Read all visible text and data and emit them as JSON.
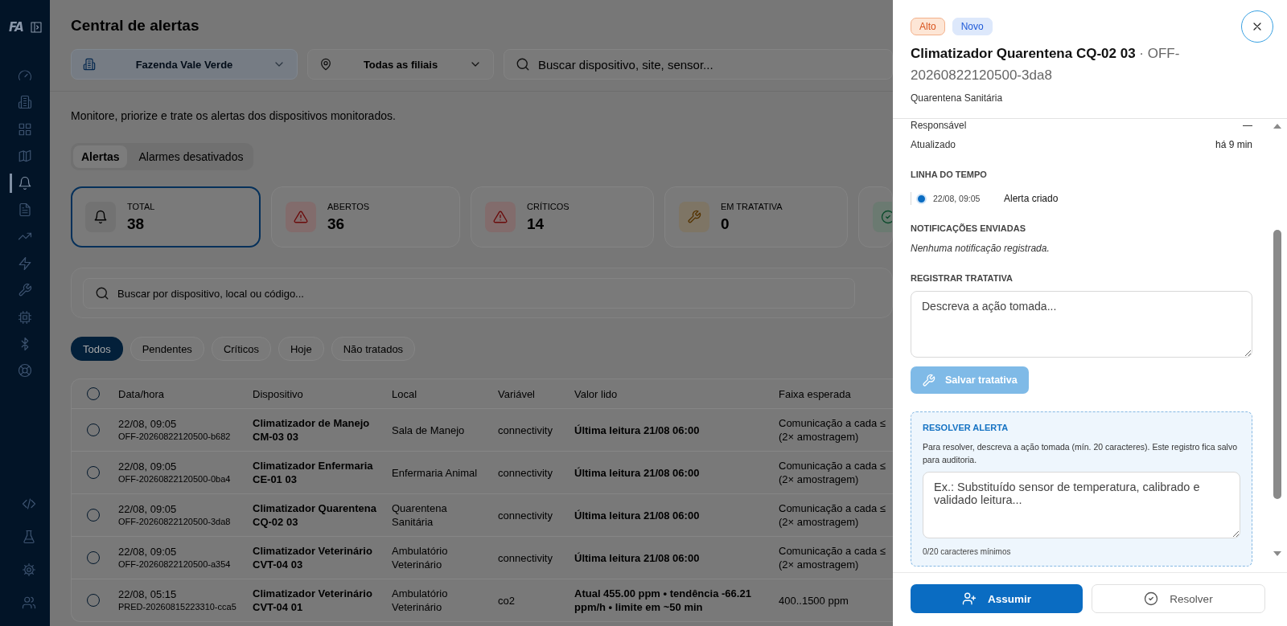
{
  "sidebar": {
    "logo": "FA",
    "items": [
      {
        "selected": false
      },
      {
        "selected": false
      },
      {
        "selected": false
      },
      {
        "selected": false
      },
      {
        "selected": true
      },
      {
        "selected": false
      },
      {
        "selected": false
      },
      {
        "selected": false
      },
      {
        "selected": false
      },
      {
        "selected": false
      },
      {
        "selected": false
      },
      {
        "selected": false
      }
    ],
    "footer_items": [
      {
        "selected": false
      },
      {
        "selected": false
      },
      {
        "selected": false
      },
      {
        "selected": false
      }
    ]
  },
  "page": {
    "title": "Central de alertas",
    "farm_select": {
      "value": "Fazenda Vale Verde"
    },
    "branch_select": {
      "value": "Todas as filiais"
    },
    "search": {
      "placeholder": "Buscar dispositivo, site, sensor..."
    },
    "description": "Monitore, priorize e trate os alertas dos dispositivos monitorados.",
    "tabs": [
      {
        "label": "Alertas",
        "selected": true
      },
      {
        "label": "Alarmes desativados",
        "selected": false
      }
    ],
    "stats": [
      {
        "kind": "total",
        "label": "TOTAL",
        "value": "38",
        "selected": true
      },
      {
        "kind": "open",
        "label": "ABERTOS",
        "value": "36",
        "selected": false
      },
      {
        "kind": "critical",
        "label": "CRÍTICOS",
        "value": "14",
        "selected": false
      },
      {
        "kind": "handling",
        "label": "EM TRATATIVA",
        "value": "0",
        "selected": false
      },
      {
        "kind": "resolved",
        "selected": false
      }
    ],
    "list_search": {
      "placeholder": "Buscar por dispositivo, local ou código..."
    },
    "filters": [
      {
        "label": "Todos",
        "selected": true
      },
      {
        "label": "Pendentes",
        "selected": false
      },
      {
        "label": "Críticos",
        "selected": false
      },
      {
        "label": "Hoje",
        "selected": false
      },
      {
        "label": "Não tratados",
        "selected": false
      }
    ],
    "table": {
      "all_checked": false,
      "columns": [
        "Data/hora",
        "Dispositivo",
        "Local",
        "Variável",
        "Valor lido",
        "Faixa esperada"
      ],
      "rows": [
        {
          "checked": false,
          "time": "22/08, 09:05",
          "code": "OFF-20260822120500-b682",
          "device": "Climatizador de Manejo CM-03 03",
          "local": "Sala de Manejo",
          "variable": "connectivity",
          "value": "Última leitura 21/08 06:00",
          "range": "Comunicação a cada ≤ (2× amostragem)"
        },
        {
          "checked": false,
          "time": "22/08, 09:05",
          "code": "OFF-20260822120500-0ba4",
          "device": "Climatizador Enfermaria CE-01 03",
          "local": "Enfermaria Animal",
          "variable": "connectivity",
          "value": "Última leitura 21/08 06:00",
          "range": "Comunicação a cada ≤ (2× amostragem)"
        },
        {
          "checked": false,
          "time": "22/08, 09:05",
          "code": "OFF-20260822120500-3da8",
          "device": "Climatizador Quarentena CQ-02 03",
          "local": "Quarentena Sanitária",
          "variable": "connectivity",
          "value": "Última leitura 21/08 06:00",
          "range": "Comunicação a cada ≤ (2× amostragem)"
        },
        {
          "checked": false,
          "time": "22/08, 09:05",
          "code": "OFF-20260822120500-a354",
          "device": "Climatizador Veterinário CVT-04 03",
          "local": "Ambulatório Veterinário",
          "variable": "connectivity",
          "value": "Última leitura 21/08 06:00",
          "range": "Comunicação a cada ≤ (2× amostragem)"
        },
        {
          "checked": false,
          "time": "22/08, 05:15",
          "code": "PRED-20260815223310-cca5",
          "device": "Climatizador Veterinário CVT-04 01",
          "local": "Ambulatório Veterinário",
          "variable": "co2",
          "value": "Atual 455.00 ppm • tendência -66.21 ppm/h • limite em ~50 min",
          "range": "400..1500 ppm"
        }
      ]
    }
  },
  "drawer": {
    "badges": [
      {
        "kind": "severity",
        "label": "Alto"
      },
      {
        "kind": "status",
        "label": "Novo"
      }
    ],
    "title": "**Climatizador Quarentena CQ-02 03** · OFF-20260822120500-3da8",
    "location": "Quarentena Sanitária",
    "details": [
      {
        "label": "Responsável",
        "value": "—"
      },
      {
        "label": "Atualizado",
        "value": "há 9 min"
      }
    ],
    "timeline": {
      "heading": "LINHA DO TEMPO",
      "events": [
        {
          "time": "22/08, 09:05",
          "text": "Alerta criado"
        }
      ]
    },
    "notifications": {
      "heading": "NOTIFICAÇÕES ENVIADAS",
      "empty_text": "Nenhuma notificação registrada."
    },
    "treatment": {
      "heading": "REGISTRAR TRATATIVA",
      "placeholder": "Descreva a ação tomada...",
      "button": "Salvar tratativa",
      "disabled": true
    },
    "resolve": {
      "heading": "RESOLVER ALERTA",
      "help": "Para resolver, descreva a ação tomada (mín. 20 caracteres). Este registro fica salvo para auditoria.",
      "placeholder": "Ex.: Substituído sensor de temperatura, calibrado e validado leitura...",
      "counter": "0/20 caracteres mínimos"
    },
    "actions": [
      {
        "kind": "primary",
        "label": "Assumir"
      },
      {
        "kind": "secondary",
        "label": "Resolver"
      }
    ]
  }
}
